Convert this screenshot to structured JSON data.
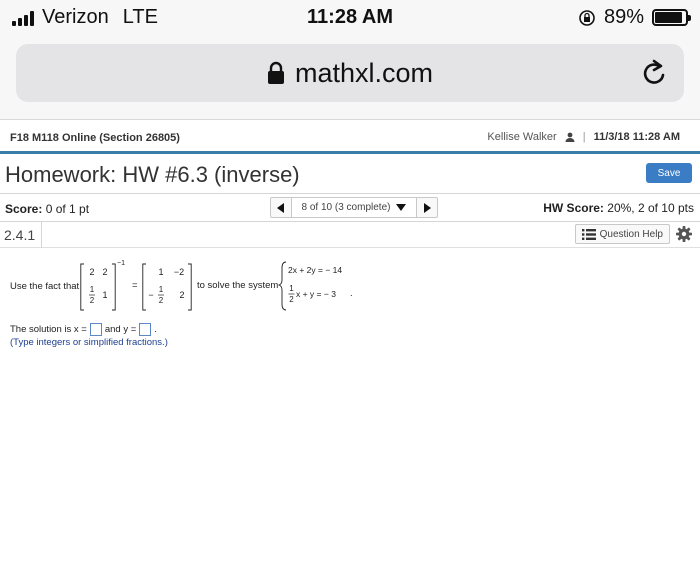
{
  "status_bar": {
    "carrier": "Verizon",
    "network": "LTE",
    "time": "11:28 AM",
    "battery_percent": "89%",
    "battery_level": 0.89
  },
  "browser": {
    "url": "mathxl.com",
    "icons": [
      "lock-icon",
      "reload-icon"
    ]
  },
  "course": {
    "name": "F18 M118 Online (Section 26805)",
    "user": "Kellise Walker",
    "datetime": "11/3/18 11:28 AM"
  },
  "homework": {
    "title": "Homework: HW #6.3 (inverse)",
    "save_label": "Save"
  },
  "score": {
    "label": "Score:",
    "value": "0 of 1 pt",
    "progress": "8 of 10 (3 complete)",
    "hw_label": "HW Score:",
    "hw_value": "20%, 2 of 10 pts"
  },
  "question": {
    "number": "2.4.1",
    "help_label": "Question Help",
    "text_use": "Use the fact that",
    "equals": "=",
    "text_solve": "to solve the system",
    "period": ".",
    "matrix_a": [
      [
        "2",
        "2"
      ],
      [
        "1/2",
        "1"
      ]
    ],
    "inverse_exponent": "-1",
    "matrix_b": [
      [
        "1",
        "-2"
      ],
      [
        "-1/2",
        "2"
      ]
    ],
    "system": [
      "2x + 2y = - 14",
      "1/2 x + y = - 3"
    ],
    "solution_prefix": "The solution is x =",
    "solution_mid": "and y =",
    "solution_end": ".",
    "hint": "(Type integers or simplified fractions.)"
  }
}
